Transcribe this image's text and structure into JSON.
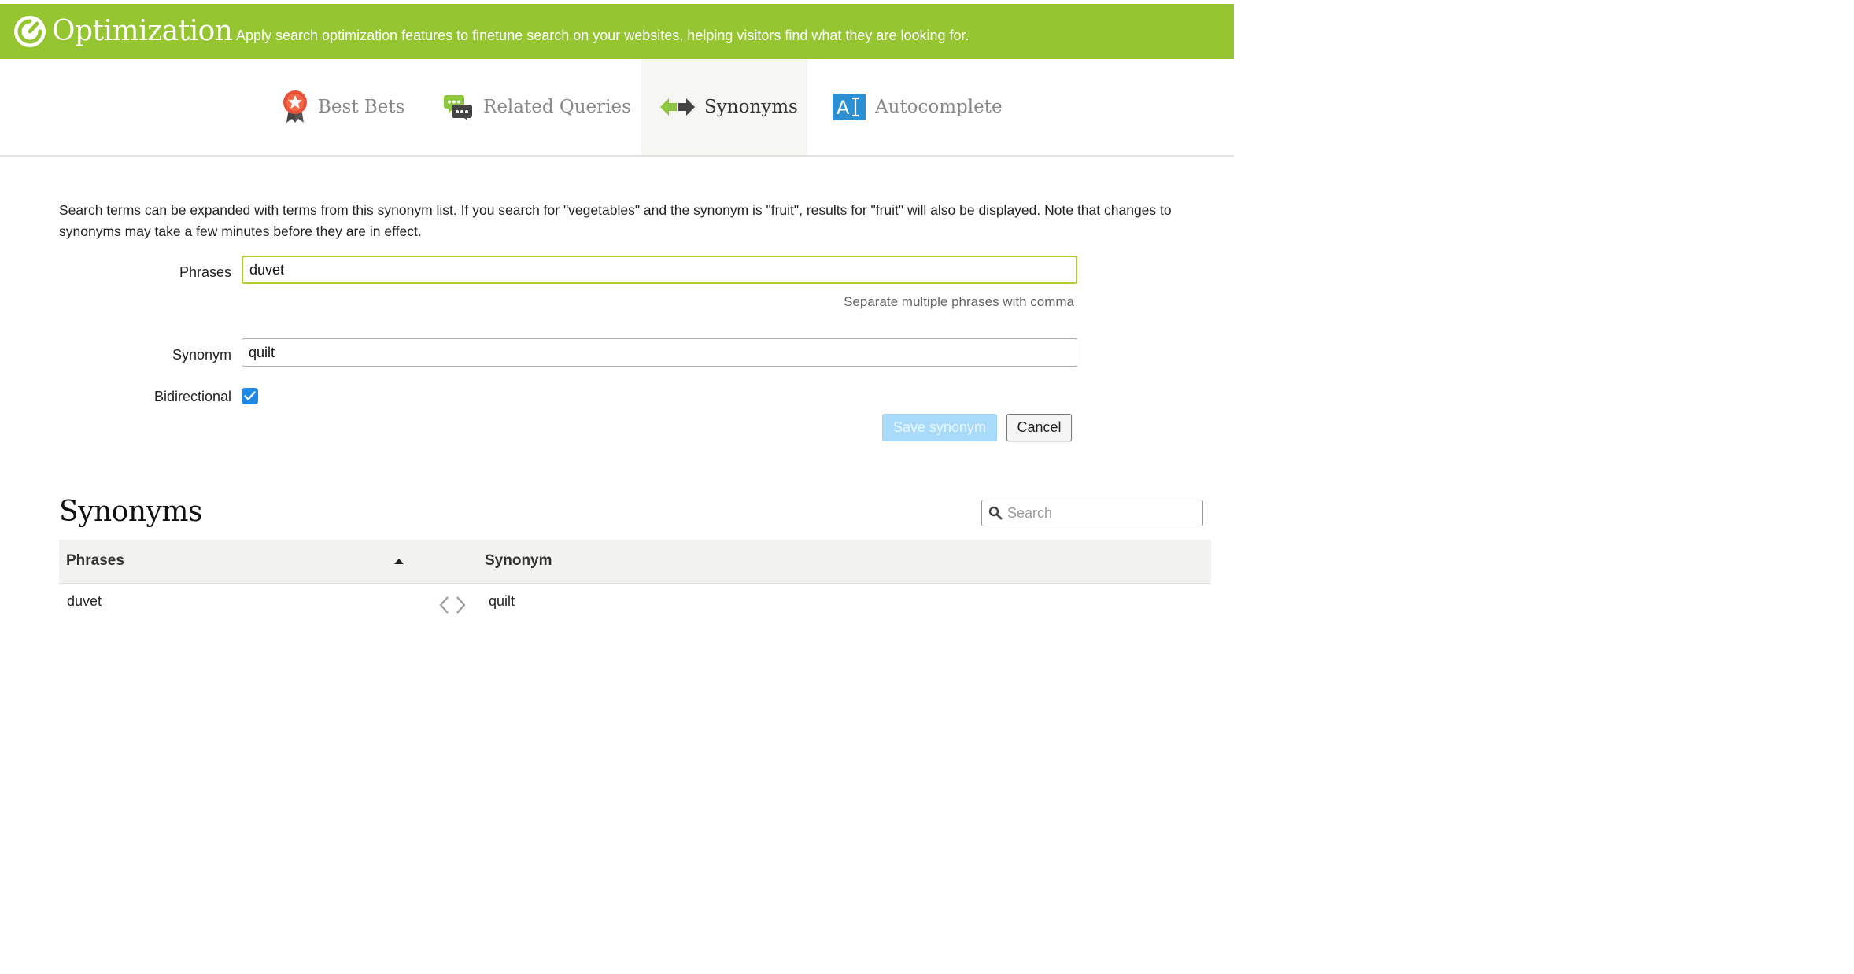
{
  "header": {
    "title": "Optimization",
    "subtitle": "Apply search optimization features to finetune search on your websites, helping visitors find what they are looking for.",
    "background_color": "#95c530"
  },
  "tabs": [
    {
      "label": "Best Bets",
      "icon": "ribbon-star-icon",
      "active": false
    },
    {
      "label": "Related Queries",
      "icon": "chat-bubbles-icon",
      "active": false
    },
    {
      "label": "Synonyms",
      "icon": "bidirectional-arrows-icon",
      "active": true
    },
    {
      "label": "Autocomplete",
      "icon": "autocomplete-ai-icon",
      "active": false
    }
  ],
  "description": "Search terms can be expanded with terms from this synonym list. If you search for \"vegetables\" and the synonym is \"fruit\", results for \"fruit\" will also be displayed. Note that changes to synonyms may take a few minutes before they are in effect.",
  "form": {
    "phrases_label": "Phrases",
    "phrases_value": "duvet",
    "phrases_hint": "Separate multiple phrases with comma",
    "synonym_label": "Synonym",
    "synonym_value": "quilt",
    "bidirectional_label": "Bidirectional",
    "bidirectional_checked": true,
    "save_label": "Save synonym",
    "cancel_label": "Cancel"
  },
  "list": {
    "title": "Synonyms",
    "search_placeholder": "Search",
    "columns": {
      "phrases": "Phrases",
      "synonym": "Synonym"
    },
    "rows": [
      {
        "phrases": "duvet",
        "synonym": "quilt",
        "bidirectional": true
      }
    ]
  }
}
